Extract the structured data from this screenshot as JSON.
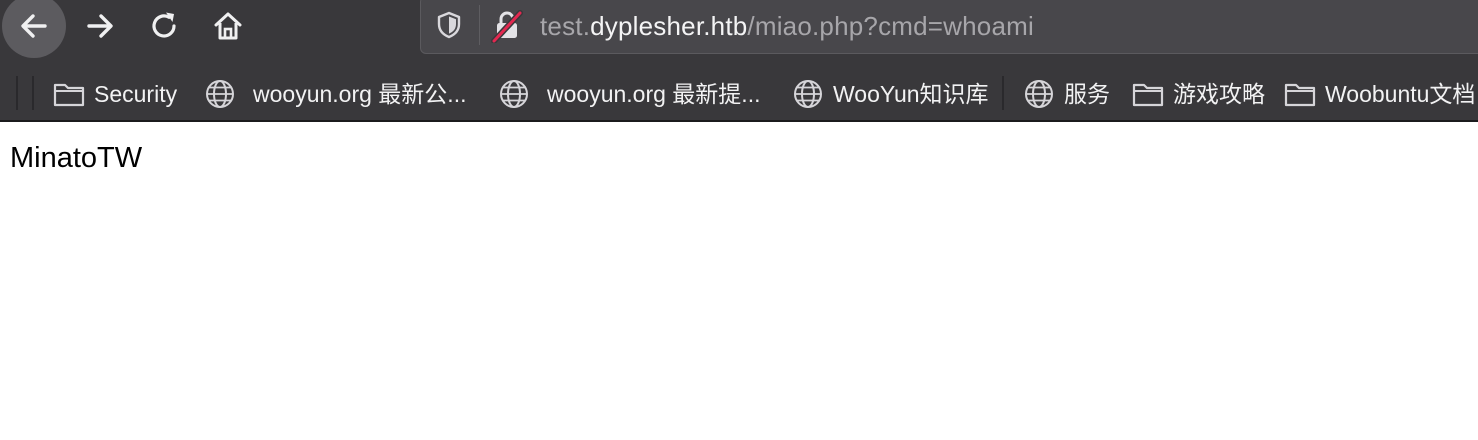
{
  "toolbar": {
    "back_icon": "arrow-left-icon",
    "forward_icon": "arrow-right-icon",
    "reload_icon": "reload-icon",
    "home_icon": "home-icon"
  },
  "urlbar": {
    "tracking_icon": "shield-icon",
    "security_icon": "insecure-lock-icon",
    "url_prefix": "test.",
    "url_domain": "dyplesher.htb",
    "url_path": "/miao.php?cmd=whoami"
  },
  "bookmarks": [
    {
      "icon": "folder-icon",
      "label": "Security"
    },
    {
      "icon": "globe-icon",
      "label": "wooyun.org 最新公..."
    },
    {
      "icon": "globe-icon",
      "label": "wooyun.org 最新提..."
    },
    {
      "icon": "globe-icon",
      "label": "WooYun知识库"
    },
    {
      "icon": "globe-icon",
      "label": "服务"
    },
    {
      "icon": "folder-icon",
      "label": "游戏攻略"
    },
    {
      "icon": "folder-icon",
      "label": "Woobuntu文档"
    }
  ],
  "page": {
    "output_text": "MinatoTW"
  },
  "colors": {
    "toolbar_bg": "#39383b",
    "urlbar_bg": "#48474b",
    "insecure_strike": "#e22850",
    "page_bg": "#ffffff"
  }
}
